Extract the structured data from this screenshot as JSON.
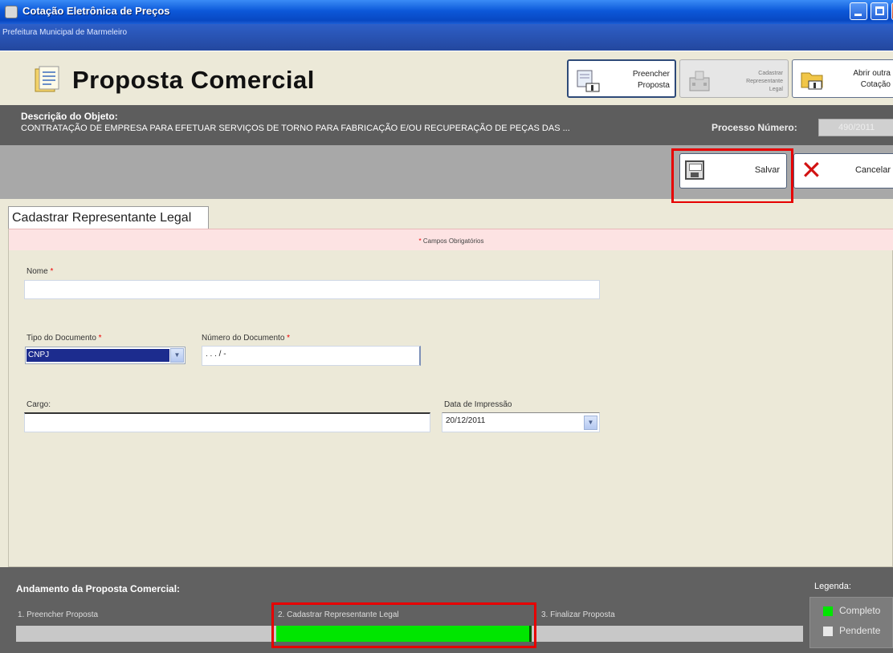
{
  "window": {
    "title": "Cotação Eletrônica de Preços",
    "subtitle": "Prefeitura Municipal de Marmeleiro"
  },
  "header": {
    "page_title": "Proposta Comercial",
    "buttons": [
      {
        "label": "Preencher\nProposta",
        "icon": "edit-proposal-icon"
      },
      {
        "label": "Cadastrar\nRepresentante\nLegal",
        "icon": "building-icon"
      },
      {
        "label": "Abrir outra\nCotação",
        "icon": "folder-open-icon"
      }
    ]
  },
  "description": {
    "label": "Descrição do Objeto:",
    "text": "CONTRATAÇÃO DE EMPRESA PARA EFETUAR SERVIÇOS DE TORNO PARA FABRICAÇÃO E/OU RECUPERAÇÃO DE PEÇAS DAS ...",
    "process_label": "Processo Número:",
    "process_number": "490/2011"
  },
  "actions": {
    "save_label": "Salvar",
    "cancel_label": "Cancelar"
  },
  "tab": {
    "label": "Cadastrar Representante Legal"
  },
  "form": {
    "required_note": "Campos Obrigatórios",
    "nome_label": "Nome",
    "nome_value": "",
    "tipo_doc_label": "Tipo do Documento",
    "tipo_doc_value": "CNPJ",
    "num_doc_label": "Número do Documento",
    "num_doc_value": ". . . / -",
    "cargo_label": "Cargo:",
    "cargo_value": "",
    "data_label": "Data de Impressão",
    "data_value": "20/12/2011"
  },
  "progress": {
    "title": "Andamento da Proposta Comercial:",
    "steps": [
      {
        "label": "1. Preencher Proposta",
        "status": "Pendente"
      },
      {
        "label": "2. Cadastrar Representante Legal",
        "status": "Completo"
      },
      {
        "label": "3. Finalizar Proposta",
        "status": "Pendente"
      }
    ]
  },
  "legend": {
    "title": "Legenda:",
    "items": [
      {
        "label": "Completo",
        "color": "#00e600"
      },
      {
        "label": "Pendente",
        "color": "#e8e8e8"
      }
    ]
  },
  "colors": {
    "highlight": "#e60000",
    "progress_complete": "#00e600"
  }
}
